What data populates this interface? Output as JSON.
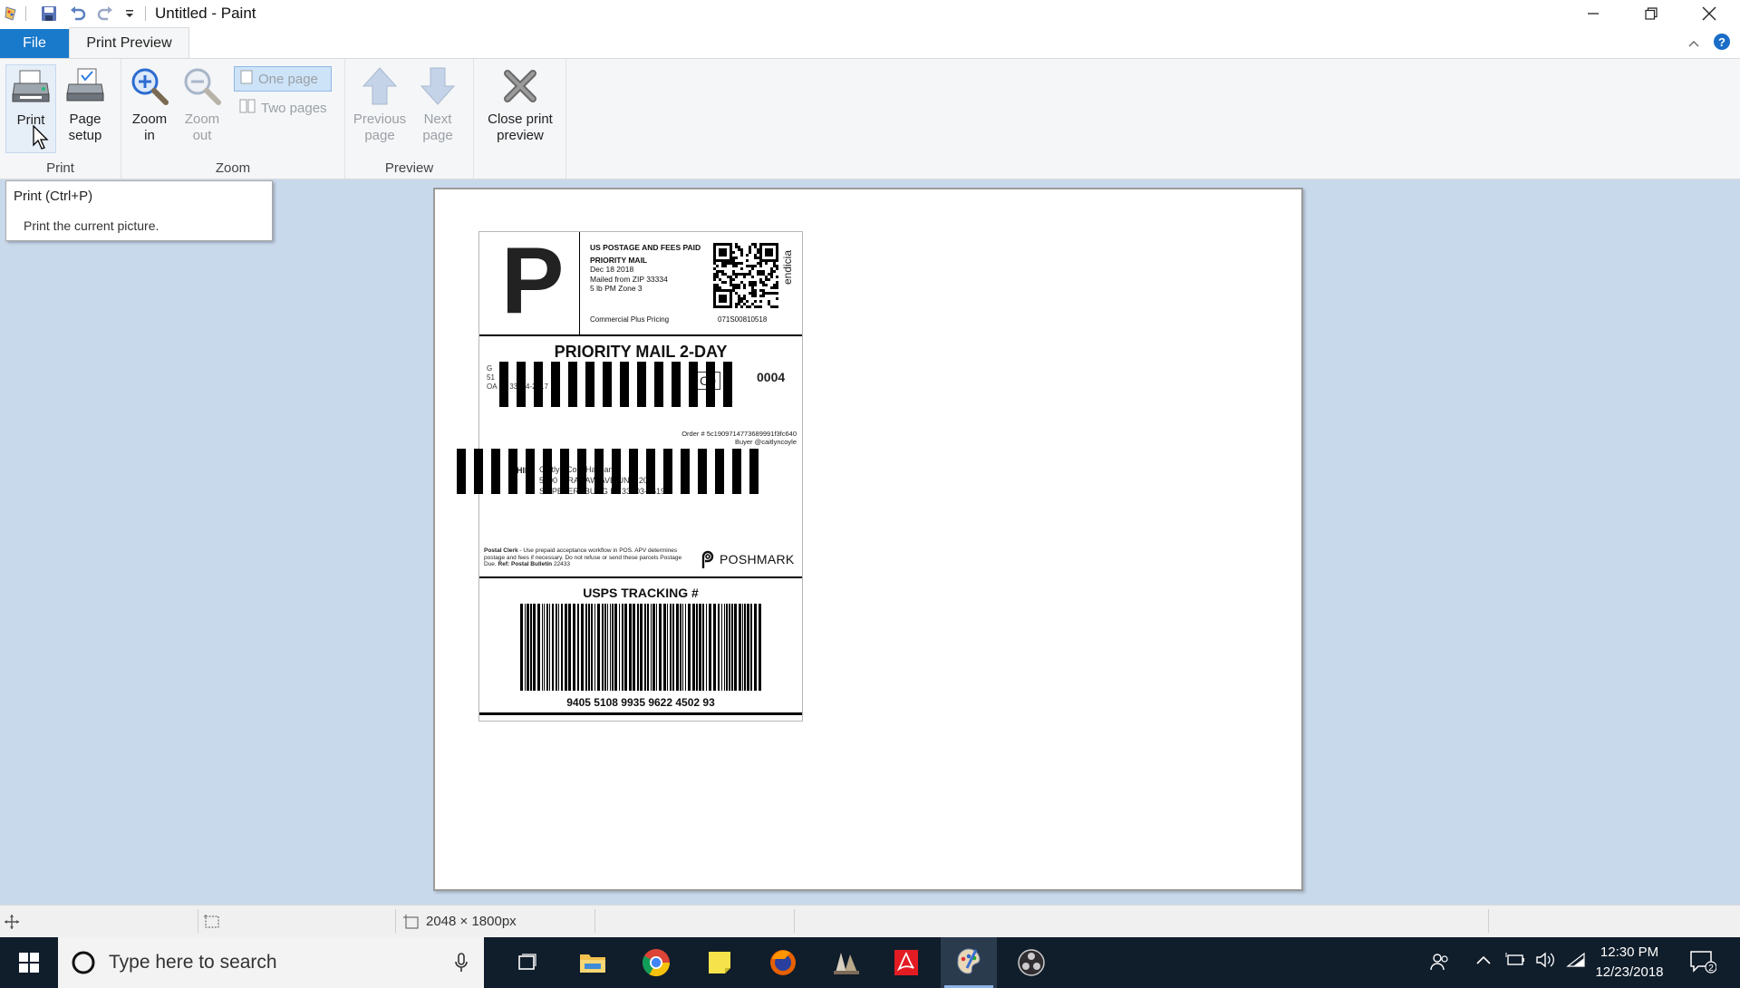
{
  "window": {
    "title": "Untitled - Paint",
    "controls": {
      "minimize": "minimize",
      "restore": "restore",
      "close": "close"
    }
  },
  "quick_access": [
    "paint-app-icon",
    "save-icon",
    "undo-icon",
    "redo-icon",
    "customize-dropdown-icon"
  ],
  "tabs": {
    "file": "File",
    "print_preview": "Print Preview"
  },
  "ribbon": {
    "groups": {
      "print": {
        "label": "Print",
        "buttons": [
          {
            "line1": "Print",
            "line2": "",
            "icon": "printer-icon",
            "enabled": true
          },
          {
            "line1": "Page",
            "line2": "setup",
            "icon": "page-setup-icon",
            "enabled": true
          }
        ]
      },
      "zoom": {
        "label": "Zoom",
        "buttons": [
          {
            "line1": "Zoom",
            "line2": "in",
            "icon": "zoom-in-icon",
            "enabled": true
          },
          {
            "line1": "Zoom",
            "line2": "out",
            "icon": "zoom-out-icon",
            "enabled": false
          }
        ],
        "one_page": "One page",
        "two_pages": "Two pages"
      },
      "preview": {
        "label": "Preview",
        "buttons": [
          {
            "line1": "Previous",
            "line2": "page",
            "icon": "arrow-up-icon",
            "enabled": false
          },
          {
            "line1": "Next",
            "line2": "page",
            "icon": "arrow-down-icon",
            "enabled": false
          }
        ]
      },
      "close": {
        "line1": "Close print",
        "line2": "preview",
        "icon": "close-x-icon"
      }
    }
  },
  "tooltip": {
    "title": "Print (Ctrl+P)",
    "description": "Print the current picture."
  },
  "label": {
    "big_letter": "P",
    "postage_line1": "US POSTAGE AND FEES PAID",
    "postage_line2": "PRIORITY MAIL",
    "date": "Dec 18 2018",
    "mailed_from": "Mailed from ZIP 33334",
    "weight_zone": "5 lb PM Zone 3",
    "pricing": "Commercial Plus Pricing",
    "account_number": "071S00810518",
    "endicia": "endicia",
    "service": "PRIORITY MAIL 2-DAY",
    "return_address": [
      "G",
      "51",
      "OA           PA          33334-2217"
    ],
    "route_code": "C0",
    "route_code2": "0004",
    "order_line": "Order # 5c1909714773689991f3fc640",
    "buyer_line": "Buyer @caitlyncoyle",
    "ship_prefix": "SHIP",
    "ship_to": [
      "Caitlyn Cole Hassan",
      "5100 N RANAW AVE UNIT 205",
      "ST PETERSBURG FL 33703-1619"
    ],
    "postal_clerk_label": "Postal Clerk",
    "postal_clerk_text": " - Use prepaid acceptance workflow in POS. APV determines postage and fees if necessary. Do not refuse or send these parcels Postage Due.",
    "postal_clerk_ref": "Ref: Postal Bulletin",
    "postal_clerk_num": " 22433",
    "brand": "POSHMARK",
    "tracking_title": "USPS TRACKING #",
    "tracking_number": "9405 5108 9935 9622 4502 93"
  },
  "status": {
    "dimensions": "2048 × 1800px"
  },
  "taskbar": {
    "search_placeholder": "Type here to search",
    "apps": [
      "task-view-icon",
      "file-explorer-icon",
      "chrome-icon",
      "sticky-notes-icon",
      "firefox-icon",
      "app-icon",
      "acrobat-icon",
      "paint-icon",
      "obs-icon"
    ],
    "time": "12:30 PM",
    "date": "12/23/2018",
    "notification_count": "2"
  }
}
